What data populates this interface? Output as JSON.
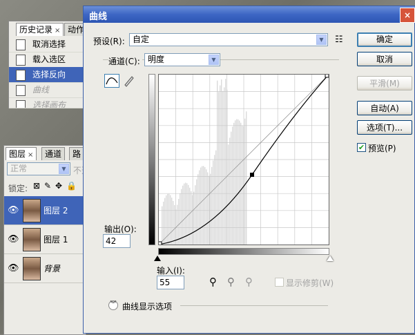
{
  "history_panel": {
    "tabs": [
      {
        "label": "历史记录",
        "close": "×"
      },
      {
        "label": "动作"
      }
    ],
    "items": [
      {
        "label": "取消选择"
      },
      {
        "label": "载入选区"
      },
      {
        "label": "选择反向"
      },
      {
        "label": "曲线"
      },
      {
        "label": "选择画布"
      }
    ]
  },
  "layers_panel": {
    "tabs": [
      {
        "label": "图层",
        "close": "×"
      },
      {
        "label": "通道"
      },
      {
        "label": "路径"
      }
    ],
    "blend_mode": "正常",
    "opacity_label": "不透",
    "lock_label": "锁定:",
    "layers": [
      {
        "name": "图层 2"
      },
      {
        "name": "图层 1"
      },
      {
        "name": "背景"
      }
    ]
  },
  "dialog": {
    "title": "曲线",
    "close_glyph": "×",
    "preset_label": "预设(R):",
    "preset_value": "自定",
    "channel_label": "通道(C):",
    "channel_value": "明度",
    "output_label": "输出(O):",
    "output_value": "42",
    "input_label": "输入(I):",
    "input_value": "55",
    "show_clipping_label": "显示修剪(W)",
    "curve_display_options_label": "曲线显示选项",
    "preview_label": "预览(P)",
    "preview_checked": true,
    "buttons": {
      "ok": "确定",
      "cancel": "取消",
      "smooth": "平滑(M)",
      "auto": "自动(A)",
      "options": "选项(T)..."
    },
    "accent_color": "#3d66c4",
    "curve": {
      "control_point": {
        "input": 55,
        "output": 42
      },
      "range": [
        0,
        255
      ]
    }
  }
}
